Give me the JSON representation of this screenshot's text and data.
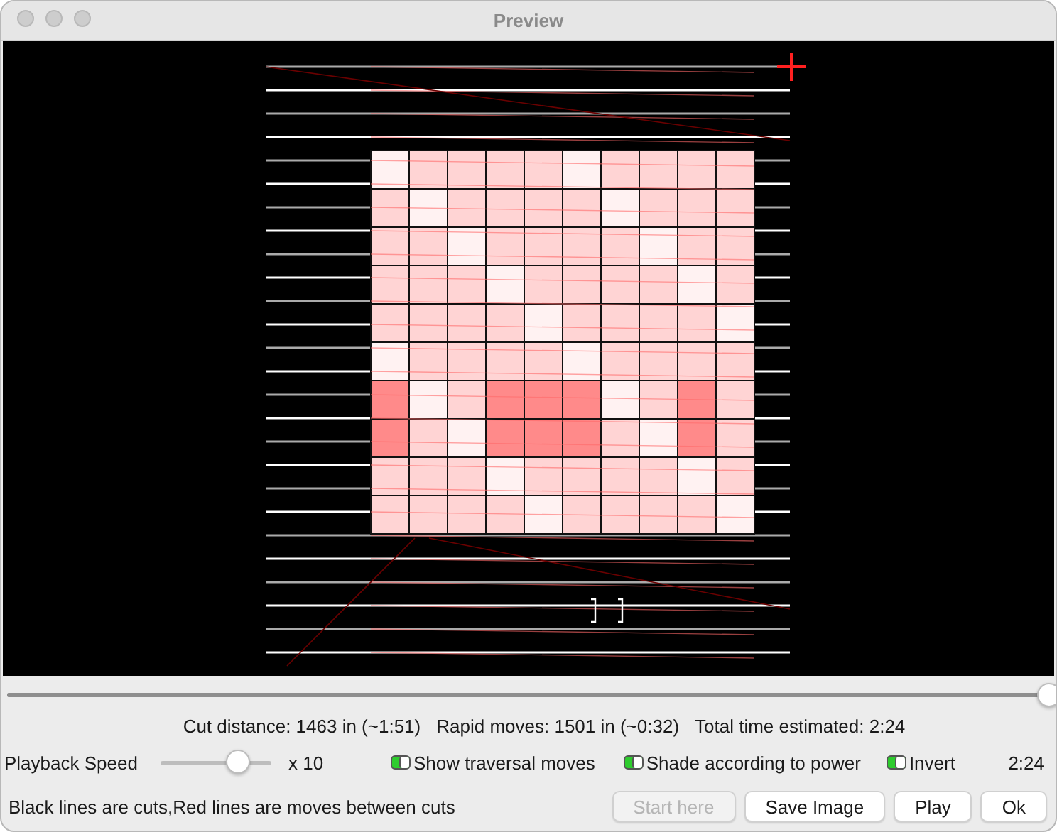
{
  "window": {
    "title": "Preview"
  },
  "timeline": {
    "level": 1.0
  },
  "stats": [
    "Cut distance: 1463 in (~1:51)",
    "Rapid moves: 1501 in (~0:32)",
    "Total time estimated: 2:24"
  ],
  "playback": {
    "label": "Playback Speed",
    "level": 0.7,
    "multiplier": "x 10"
  },
  "options": [
    {
      "label": "Show traversal moves",
      "checked": true
    },
    {
      "label": "Shade according to power",
      "checked": true
    },
    {
      "label": "Invert",
      "checked": true
    }
  ],
  "elapsed": "2:24",
  "legend": "Black lines are cuts,Red lines are moves between cuts",
  "buttons": [
    {
      "label": "Start here",
      "disabled": true
    },
    {
      "label": "Save Image",
      "disabled": false
    },
    {
      "label": "Play",
      "disabled": false
    },
    {
      "label": "Ok",
      "disabled": false
    }
  ]
}
